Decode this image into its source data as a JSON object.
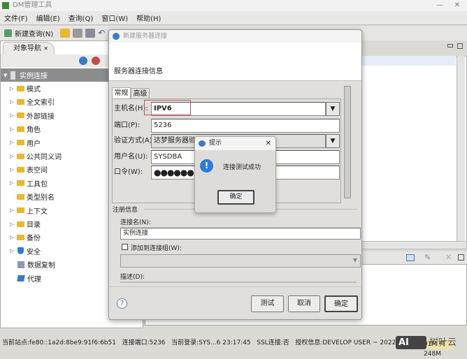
{
  "app": {
    "title": "DM管理工具"
  },
  "menu": [
    "文件(F)",
    "编辑(E)",
    "查询(Q)",
    "窗口(W)",
    "帮助(H)"
  ],
  "toolbar": {
    "new_query": "新建查询(N)"
  },
  "navigator": {
    "tab": "对象导航",
    "root": "实例连接",
    "items": [
      {
        "label": "模式",
        "icon": "folder",
        "expandable": true
      },
      {
        "label": "全文索引",
        "icon": "folder",
        "expandable": true
      },
      {
        "label": "外部链接",
        "icon": "folder",
        "expandable": true
      },
      {
        "label": "角色",
        "icon": "folder",
        "expandable": true
      },
      {
        "label": "用户",
        "icon": "folder",
        "expandable": true
      },
      {
        "label": "公共同义词",
        "icon": "folder",
        "expandable": true
      },
      {
        "label": "表空间",
        "icon": "folder",
        "expandable": true
      },
      {
        "label": "工具包",
        "icon": "folder",
        "expandable": true
      },
      {
        "label": "类型别名",
        "icon": "folder",
        "expandable": false
      },
      {
        "label": "上下文",
        "icon": "folder",
        "expandable": true
      },
      {
        "label": "目录",
        "icon": "folder",
        "expandable": true
      },
      {
        "label": "备份",
        "icon": "folder",
        "expandable": true
      },
      {
        "label": "安全",
        "icon": "shield",
        "expandable": true
      },
      {
        "label": "数据复制",
        "icon": "replicate",
        "expandable": false
      },
      {
        "label": "代理",
        "icon": "layers",
        "expandable": false
      }
    ]
  },
  "dialog": {
    "title": "新建服务器连接",
    "header": "服务器连接信息",
    "tabs": [
      "常规",
      "高级"
    ],
    "host_label": "主机名(H):",
    "host_value": "IPV6",
    "port_label": "端口(P):",
    "port_value": "5236",
    "auth_label": "验证方式(A):",
    "auth_value": "达梦服务器验证",
    "user_label": "用户名(U):",
    "user_value": "SYSDBA",
    "pwd_label": "口令(W):",
    "pwd_value": "●●●●●●",
    "reg_group": "注册信息",
    "conn_name_label": "连接名(N):",
    "conn_name_value": "实例连接",
    "add_group_label": "添加到连接组(W):",
    "desc_label": "描述(D):",
    "test": "测试",
    "cancel": "取消",
    "ok": "确定"
  },
  "prompt": {
    "title": "提示",
    "message": "连接测试成功",
    "ok": "确定"
  },
  "status": {
    "site": "当前站点:fe80::1a2d:8be9:91f6:6b51",
    "port": "连接端口:5236",
    "login": "当前登录:SYS...6 23:17:45",
    "ssl": "SSL连接:否",
    "license": "授权信息:DEVELOP USER ~ 2022-09-08",
    "memory": "101M 共 248M"
  },
  "watermark": "AI 树叶云"
}
